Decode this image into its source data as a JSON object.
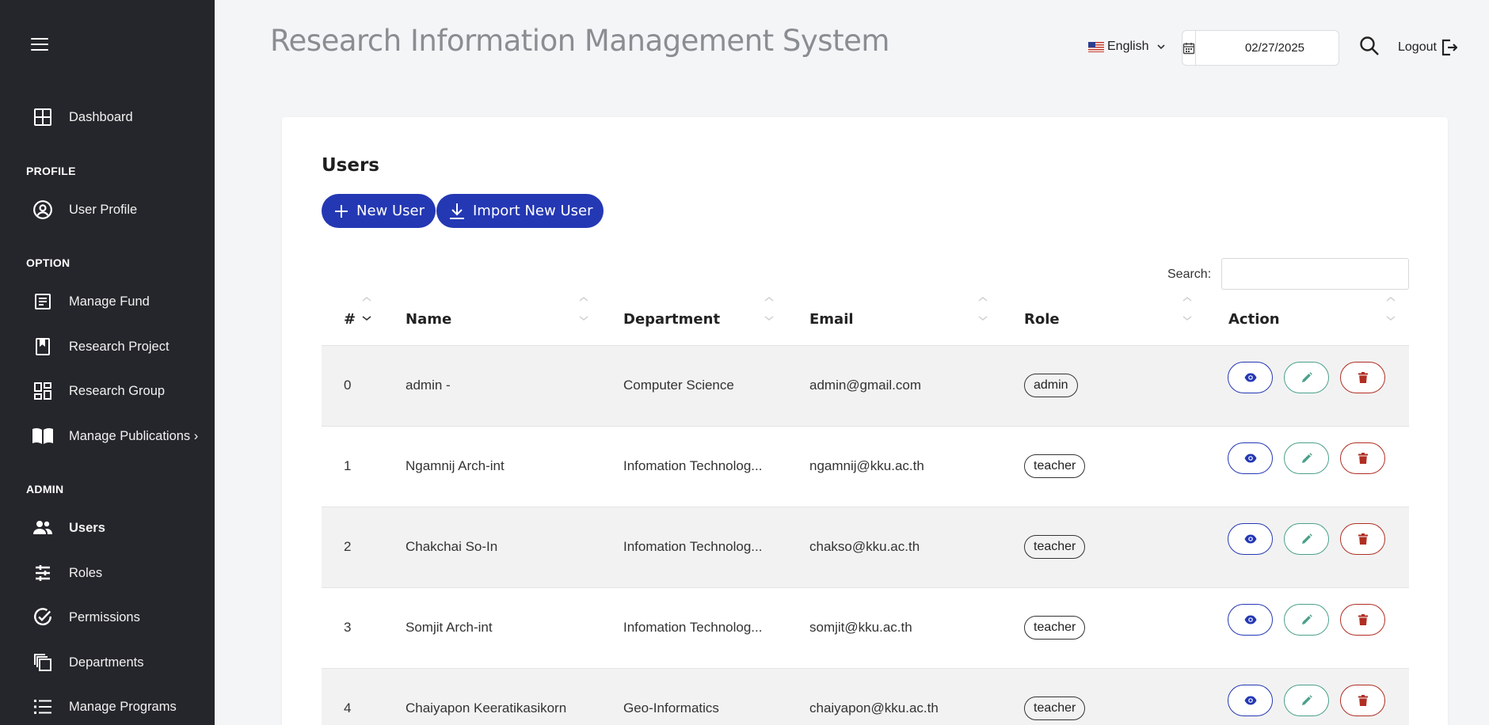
{
  "sidebar": {
    "dashboard": "Dashboard",
    "section_profile": "PROFILE",
    "user_profile": "User Profile",
    "section_option": "OPTION",
    "manage_fund": "Manage Fund",
    "research_project": "Research Project",
    "research_group": "Research Group",
    "manage_publications": "Manage Publications ›",
    "section_admin": "ADMIN",
    "users": "Users",
    "roles": "Roles",
    "permissions": "Permissions",
    "departments": "Departments",
    "manage_programs": "Manage Programs"
  },
  "header": {
    "title": "Research Information Management System",
    "language": "English",
    "date": "02/27/2025",
    "logout": "Logout"
  },
  "users_card": {
    "title": "Users",
    "new_user": "New User",
    "import_user": "Import New User",
    "search_label": "Search:",
    "search_value": ""
  },
  "table": {
    "headers": {
      "num": "#",
      "name": "Name",
      "department": "Department",
      "email": "Email",
      "role": "Role",
      "action": "Action"
    },
    "rows": [
      {
        "num": "0",
        "name": "admin -",
        "department": "Computer Science",
        "email": "admin@gmail.com",
        "role": "admin"
      },
      {
        "num": "1",
        "name": "Ngamnij Arch-int",
        "department": "Infomation Technolog...",
        "email": "ngamnij@kku.ac.th",
        "role": "teacher"
      },
      {
        "num": "2",
        "name": "Chakchai So-In",
        "department": "Infomation Technolog...",
        "email": "chakso@kku.ac.th",
        "role": "teacher"
      },
      {
        "num": "3",
        "name": "Somjit Arch-int",
        "department": "Infomation Technolog...",
        "email": "somjit@kku.ac.th",
        "role": "teacher"
      },
      {
        "num": "4",
        "name": "Chaiyapon Keeratikasikorn",
        "department": "Geo-Informatics",
        "email": "chaiyapon@kku.ac.th",
        "role": "teacher"
      }
    ]
  },
  "colors": {
    "sidebar_bg": "#25262b",
    "primary": "#2438b4",
    "edit": "#4aa08a",
    "delete": "#b02e22"
  }
}
